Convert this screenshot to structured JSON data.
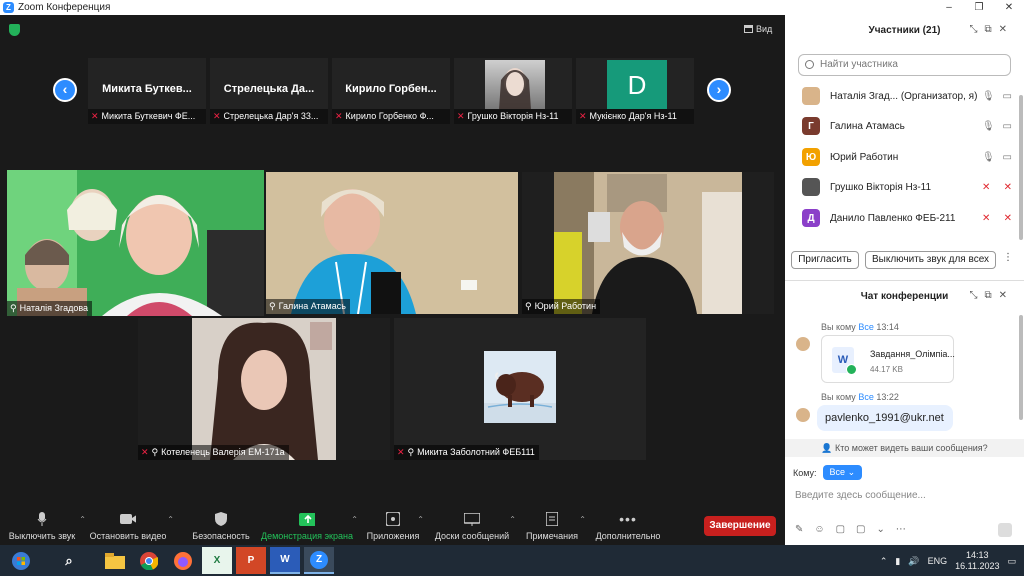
{
  "window": {
    "title": "Zoom Конференция"
  },
  "view_button": "Вид",
  "strip": [
    {
      "title": "Микита Буткев...",
      "caption": "Микита Буткевич ФЕ..."
    },
    {
      "title": "Стрелецька Да...",
      "caption": "Стрелецька Дар'я 33..."
    },
    {
      "title": "Кирило Горбен...",
      "caption": "Кирило Горбенко Ф..."
    },
    {
      "title": "",
      "caption": "Грушко Вікторія Нз-11"
    },
    {
      "title": "",
      "caption": "Мукієнко Дар'я Нз-11",
      "avatar_letter": "D",
      "avatar_color": "#169a7a"
    }
  ],
  "tiles": [
    {
      "caption": "Наталія Згадова"
    },
    {
      "caption": "Галина Атамась"
    },
    {
      "caption": "Юрий Работин"
    },
    {
      "caption": "Котеленець Валерія ЕМ-171а"
    },
    {
      "caption": "Микита Заболотний ФЕБ111"
    }
  ],
  "toolbar": {
    "mute": "Выключить звук",
    "video": "Остановить видео",
    "security": "Безопасность",
    "share": "Демонстрация экрана",
    "apps": "Приложения",
    "boards": "Доски сообщений",
    "notes": "Примечания",
    "more": "Дополнительно",
    "end": "Завершение"
  },
  "participants": {
    "title": "Участники (21)",
    "search_placeholder": "Найти участника",
    "items": [
      {
        "name": "Наталія Згад... (Организатор, я)",
        "letter": "",
        "color": "#d9b48a",
        "muted": false
      },
      {
        "name": "Галина Атамась",
        "letter": "Г",
        "color": "#7a3b2e",
        "muted": false
      },
      {
        "name": "Юрий Работин",
        "letter": "Ю",
        "color": "#f2a100",
        "muted": false
      },
      {
        "name": "Грушко Вікторія Нз-11",
        "letter": "",
        "color": "#555555",
        "muted": true
      },
      {
        "name": "Данило Павленко ФЕБ-211",
        "letter": "Д",
        "color": "#8b3fc9",
        "muted": true
      }
    ],
    "invite": "Пригласить",
    "mute_all": "Выключить звук для всех"
  },
  "chat": {
    "title": "Чат конференции",
    "messages": [
      {
        "meta": "Вы кому",
        "to": "Все",
        "time": "13:14",
        "file_name": "Завдання_Олімпіа...",
        "file_size": "44.17 KB"
      },
      {
        "meta": "Вы кому",
        "to": "Все",
        "time": "13:22",
        "text": "pavlenko_1991@ukr.net"
      }
    ],
    "visibility": "Кто может видеть ваши сообщения?",
    "to_label": "Кому:",
    "to_value": "Все",
    "input_placeholder": "Введите здесь сообщение..."
  },
  "taskbar": {
    "lang": "ENG",
    "time": "14:13",
    "date": "16.11.2023"
  }
}
